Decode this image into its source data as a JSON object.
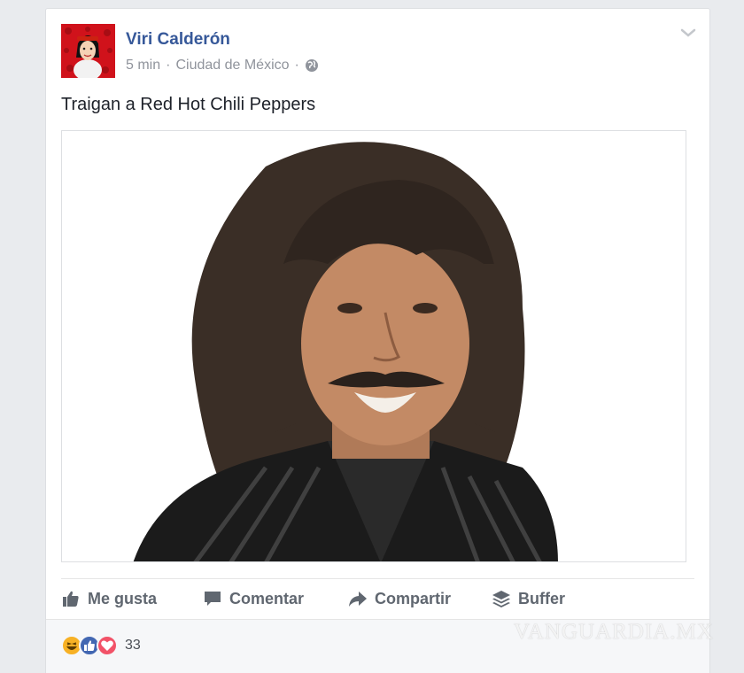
{
  "post": {
    "author": "Viri Calderón",
    "time": "5 min",
    "location": "Ciudad de México",
    "separator": "·",
    "text": "Traigan a Red Hot Chili Peppers",
    "photo_subject": "long-haired man with mustache in striped jacket"
  },
  "actions": {
    "like": "Me gusta",
    "comment": "Comentar",
    "share": "Compartir",
    "buffer": "Buffer"
  },
  "reactions": {
    "types": [
      "haha",
      "like",
      "love"
    ],
    "count": "33"
  },
  "watermark": "VANGUARDIA.MX",
  "colors": {
    "link": "#365899",
    "meta": "#90949c",
    "action": "#606770",
    "avatar_bg": "#d0121b",
    "like_blue": "#4267b2",
    "love_red": "#f25268",
    "haha_yellow": "#f7b125"
  }
}
